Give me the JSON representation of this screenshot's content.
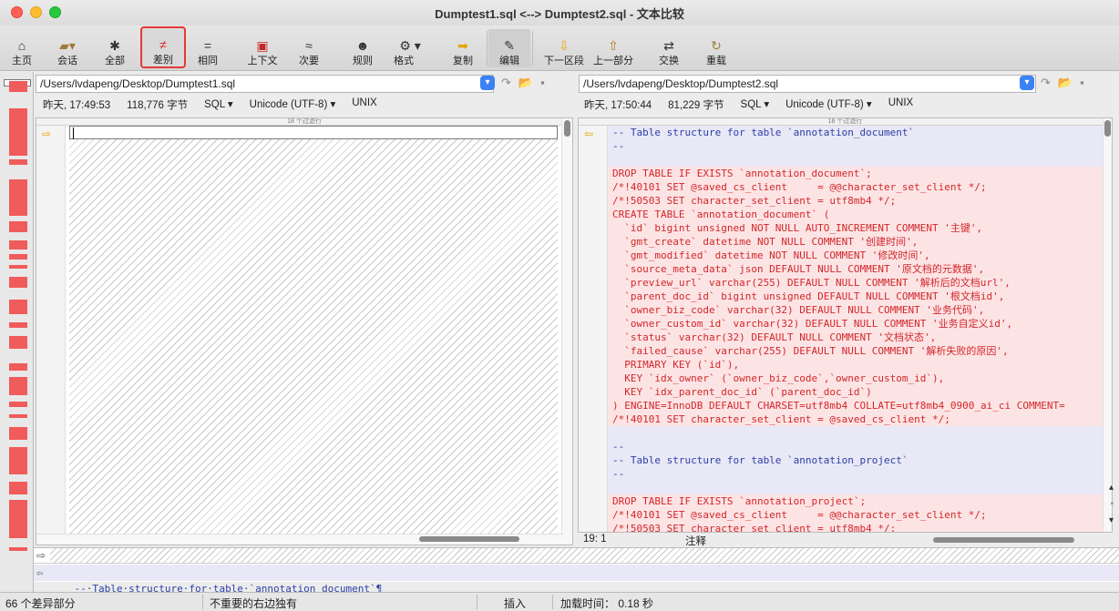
{
  "window": {
    "title": "Dumptest1.sql <--> Dumptest2.sql - 文本比较"
  },
  "toolbar": {
    "home": "主页",
    "session": "会话",
    "all": "全部",
    "diffs": "差别",
    "same": "相同",
    "context": "上下文",
    "minor": "次要",
    "rules": "规则",
    "format": "格式",
    "copy": "复制",
    "edit": "编辑",
    "next_section": "下一区段",
    "prev_section": "上一部分",
    "swap": "交换",
    "reload": "重载"
  },
  "left": {
    "path": "/Users/lvdapeng/Desktop/Dumptest1.sql",
    "time": "昨天, 17:49:53",
    "size": "118,776 字节",
    "lang": "SQL",
    "encoding": "Unicode (UTF-8)",
    "eol": "UNIX",
    "filtered": "18 个过滤行"
  },
  "right": {
    "path": "/Users/lvdapeng/Desktop/Dumptest2.sql",
    "time": "昨天, 17:50:44",
    "size": "81,229 字节",
    "lang": "SQL",
    "encoding": "Unicode (UTF-8)",
    "eol": "UNIX",
    "filtered": "18 个过滤行",
    "lines": [
      {
        "t": "-- Table structure for table `annotation_document`",
        "k": "c"
      },
      {
        "t": "--",
        "k": "c"
      },
      {
        "t": "",
        "k": "c"
      },
      {
        "t": "DROP TABLE IF EXISTS `annotation_document`;",
        "k": "d"
      },
      {
        "t": "/*!40101 SET @saved_cs_client     = @@character_set_client */;",
        "k": "d"
      },
      {
        "t": "/*!50503 SET character_set_client = utf8mb4 */;",
        "k": "d"
      },
      {
        "t": "CREATE TABLE `annotation_document` (",
        "k": "d"
      },
      {
        "t": "  `id` bigint unsigned NOT NULL AUTO_INCREMENT COMMENT '主键',",
        "k": "d"
      },
      {
        "t": "  `gmt_create` datetime NOT NULL COMMENT '创建时间',",
        "k": "d"
      },
      {
        "t": "  `gmt_modified` datetime NOT NULL COMMENT '修改时间',",
        "k": "d"
      },
      {
        "t": "  `source_meta_data` json DEFAULT NULL COMMENT '原文档的元数据',",
        "k": "d"
      },
      {
        "t": "  `preview_url` varchar(255) DEFAULT NULL COMMENT '解析后的文档url',",
        "k": "d"
      },
      {
        "t": "  `parent_doc_id` bigint unsigned DEFAULT NULL COMMENT '根文档id',",
        "k": "d"
      },
      {
        "t": "  `owner_biz_code` varchar(32) DEFAULT NULL COMMENT '业务代码',",
        "k": "d"
      },
      {
        "t": "  `owner_custom_id` varchar(32) DEFAULT NULL COMMENT '业务自定义id',",
        "k": "d"
      },
      {
        "t": "  `status` varchar(32) DEFAULT NULL COMMENT '文档状态',",
        "k": "d"
      },
      {
        "t": "  `failed_cause` varchar(255) DEFAULT NULL COMMENT '解析失败的原因',",
        "k": "d"
      },
      {
        "t": "  PRIMARY KEY (`id`),",
        "k": "d"
      },
      {
        "t": "  KEY `idx_owner` (`owner_biz_code`,`owner_custom_id`),",
        "k": "d"
      },
      {
        "t": "  KEY `idx_parent_doc_id` (`parent_doc_id`)",
        "k": "d"
      },
      {
        "t": ") ENGINE=InnoDB DEFAULT CHARSET=utf8mb4 COLLATE=utf8mb4_0900_ai_ci COMMENT=",
        "k": "d"
      },
      {
        "t": "/*!40101 SET character_set_client = @saved_cs_client */;",
        "k": "d"
      },
      {
        "t": "",
        "k": "c"
      },
      {
        "t": "--",
        "k": "c"
      },
      {
        "t": "-- Table structure for table `annotation_project`",
        "k": "c"
      },
      {
        "t": "--",
        "k": "c"
      },
      {
        "t": "",
        "k": "c"
      },
      {
        "t": "DROP TABLE IF EXISTS `annotation_project`;",
        "k": "d"
      },
      {
        "t": "/*!40101 SET @saved_cs_client     = @@character_set_client */;",
        "k": "d"
      },
      {
        "t": "/*!50503 SET character_set_client = utf8mb4 */;",
        "k": "d"
      }
    ],
    "cursor_pos": "19: 1",
    "syntax_item": "注释"
  },
  "detail": {
    "line": "--·Table·structure·for·table·`annotation_document`¶"
  },
  "status": {
    "diff_count": "66 个差异部分",
    "right_orphan": "不重要的右边独有",
    "mode": "插入",
    "load_time": "加载时间： 0.18 秒"
  },
  "colors": {
    "diff": "#fde4e4",
    "context": "#e8e8f6",
    "active_outline": "#e53935"
  }
}
